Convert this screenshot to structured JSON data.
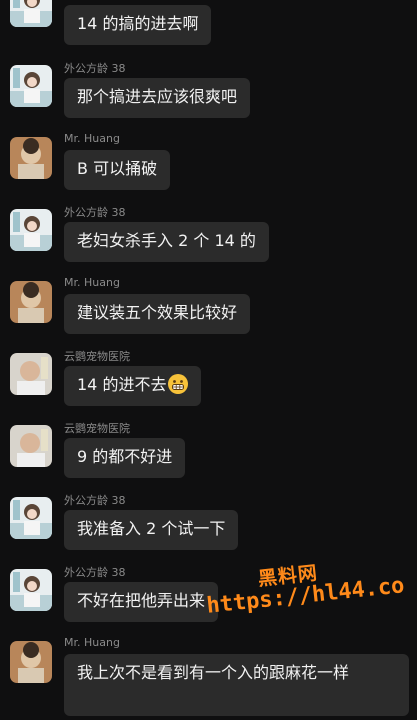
{
  "messages": [
    {
      "sender": "",
      "text": "14 的搞的进去啊",
      "avatar": "girl-avatar"
    },
    {
      "sender": "外公方龄 38",
      "text": "那个搞进去应该很爽吧",
      "avatar": "girl-avatar"
    },
    {
      "sender": "Mr. Huang",
      "text": "B 可以捅破",
      "avatar": "man-avatar"
    },
    {
      "sender": "外公方龄 38",
      "text": "老妇女杀手入 2 个 14 的",
      "avatar": "girl-avatar"
    },
    {
      "sender": "Mr. Huang",
      "text": "建议装五个效果比较好",
      "avatar": "man-avatar"
    },
    {
      "sender": "云鹦宠物医院",
      "text": "14 的进不去",
      "avatar": "elder-avatar",
      "emoji": "grin-emoji"
    },
    {
      "sender": "云鹦宠物医院",
      "text": "9 的都不好进",
      "avatar": "elder-avatar"
    },
    {
      "sender": "外公方龄 38",
      "text": "我准备入 2 个试一下",
      "avatar": "girl-avatar"
    },
    {
      "sender": "外公方龄 38",
      "text": "不好在把他弄出来",
      "avatar": "girl-avatar"
    },
    {
      "sender": "Mr. Huang",
      "text": "我上次不是看到有一个入的跟麻花一样",
      "avatar": "man-avatar"
    }
  ],
  "watermark": {
    "site_name": "黑料网",
    "url": "https://hl44.co"
  },
  "colors": {
    "background": "#0f0f10",
    "bubble": "#2b2b2b",
    "text": "#f2f2f2",
    "sender": "#8a8a8a",
    "watermark": "#ff8a1a"
  }
}
